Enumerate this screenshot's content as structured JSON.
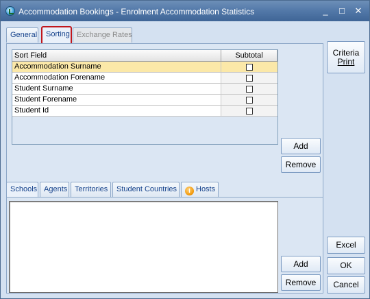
{
  "window": {
    "title": "Accommodation Bookings - Enrolment Accommodation Statistics",
    "minimize_glyph": "_",
    "maximize_glyph": "□",
    "close_glyph": "✕"
  },
  "top_tabs": [
    {
      "label": "General",
      "state": "normal"
    },
    {
      "label": "Sorting",
      "state": "active-highlighted"
    },
    {
      "label": "Exchange Rates",
      "state": "disabled"
    }
  ],
  "sort_grid": {
    "columns": [
      "Sort Field",
      "Subtotal"
    ],
    "rows": [
      {
        "field": "Accommodation Surname",
        "subtotal": false,
        "selected": true
      },
      {
        "field": "Accommodation Forename",
        "subtotal": false,
        "selected": false
      },
      {
        "field": "Student Surname",
        "subtotal": false,
        "selected": false
      },
      {
        "field": "Student Forename",
        "subtotal": false,
        "selected": false
      },
      {
        "field": "Student Id",
        "subtotal": false,
        "selected": false
      }
    ]
  },
  "sort_buttons": {
    "add": "Add",
    "remove": "Remove"
  },
  "bottom_tabs": [
    {
      "label": "Schools",
      "icon": null
    },
    {
      "label": "Agents",
      "icon": null
    },
    {
      "label": "Territories",
      "icon": null
    },
    {
      "label": "Student Countries",
      "icon": null
    },
    {
      "label": "Hosts",
      "icon": "info-icon"
    }
  ],
  "list_buttons": {
    "add": "Add",
    "remove": "Remove"
  },
  "side_buttons": {
    "criteria_line1": "Criteria",
    "criteria_line2": "Print",
    "excel": "Excel",
    "ok": "OK",
    "cancel": "Cancel"
  },
  "colors": {
    "titlebar": "#5278a8",
    "selected_row": "#fbe8a8",
    "highlight_outline": "#c0161b",
    "tab_text": "#15428b"
  }
}
